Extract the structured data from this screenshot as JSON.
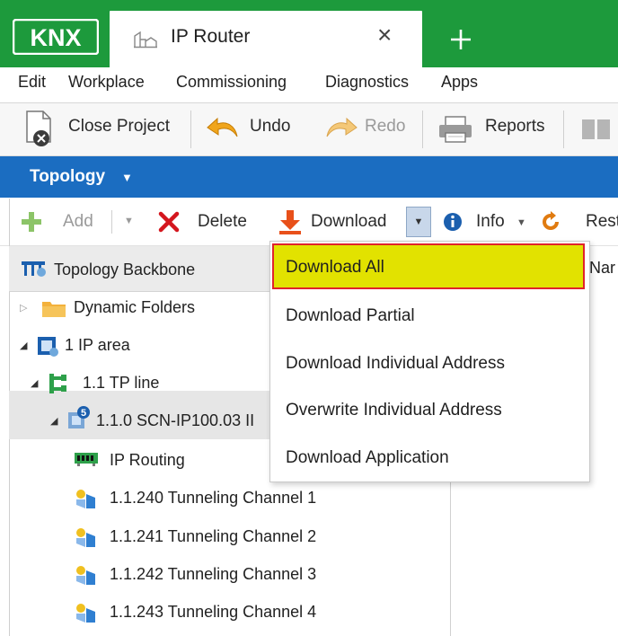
{
  "window": {
    "logo_text": "KNX",
    "tab_title": "IP Router",
    "tab_close": "×",
    "new_tab": "+"
  },
  "menu": [
    "Edit",
    "Workplace",
    "Commissioning",
    "Diagnostics",
    "Apps"
  ],
  "toolbar": {
    "close_project": "Close Project",
    "undo": "Undo",
    "redo": "Redo",
    "reports": "Reports"
  },
  "panel": {
    "title": "Topology"
  },
  "subtoolbar": {
    "add": "Add",
    "delete": "Delete",
    "download": "Download",
    "info": "Info",
    "reset_partial": "Rest"
  },
  "tree": {
    "header": "Topology Backbone",
    "items": [
      "Dynamic Folders",
      "1 IP area",
      "1.1 TP line",
      "1.1.0 SCN-IP100.03 II",
      "IP Routing",
      "1.1.240 Tunneling Channel 1",
      "1.1.241 Tunneling Channel 2",
      "1.1.242 Tunneling Channel 3",
      "1.1.243 Tunneling Channel 4"
    ]
  },
  "list_header": {
    "name_partial": "Nar"
  },
  "download_menu": {
    "items": [
      "Download All",
      "Download Partial",
      "Download Individual Address",
      "Overwrite Individual Address",
      "Download Application"
    ],
    "highlighted": "Download All"
  },
  "colors": {
    "titlebar_green": "#1d9a3c",
    "panel_blue": "#1b6dc1",
    "highlight_yellow": "#e2e200",
    "highlight_border_red": "#e0232b"
  }
}
